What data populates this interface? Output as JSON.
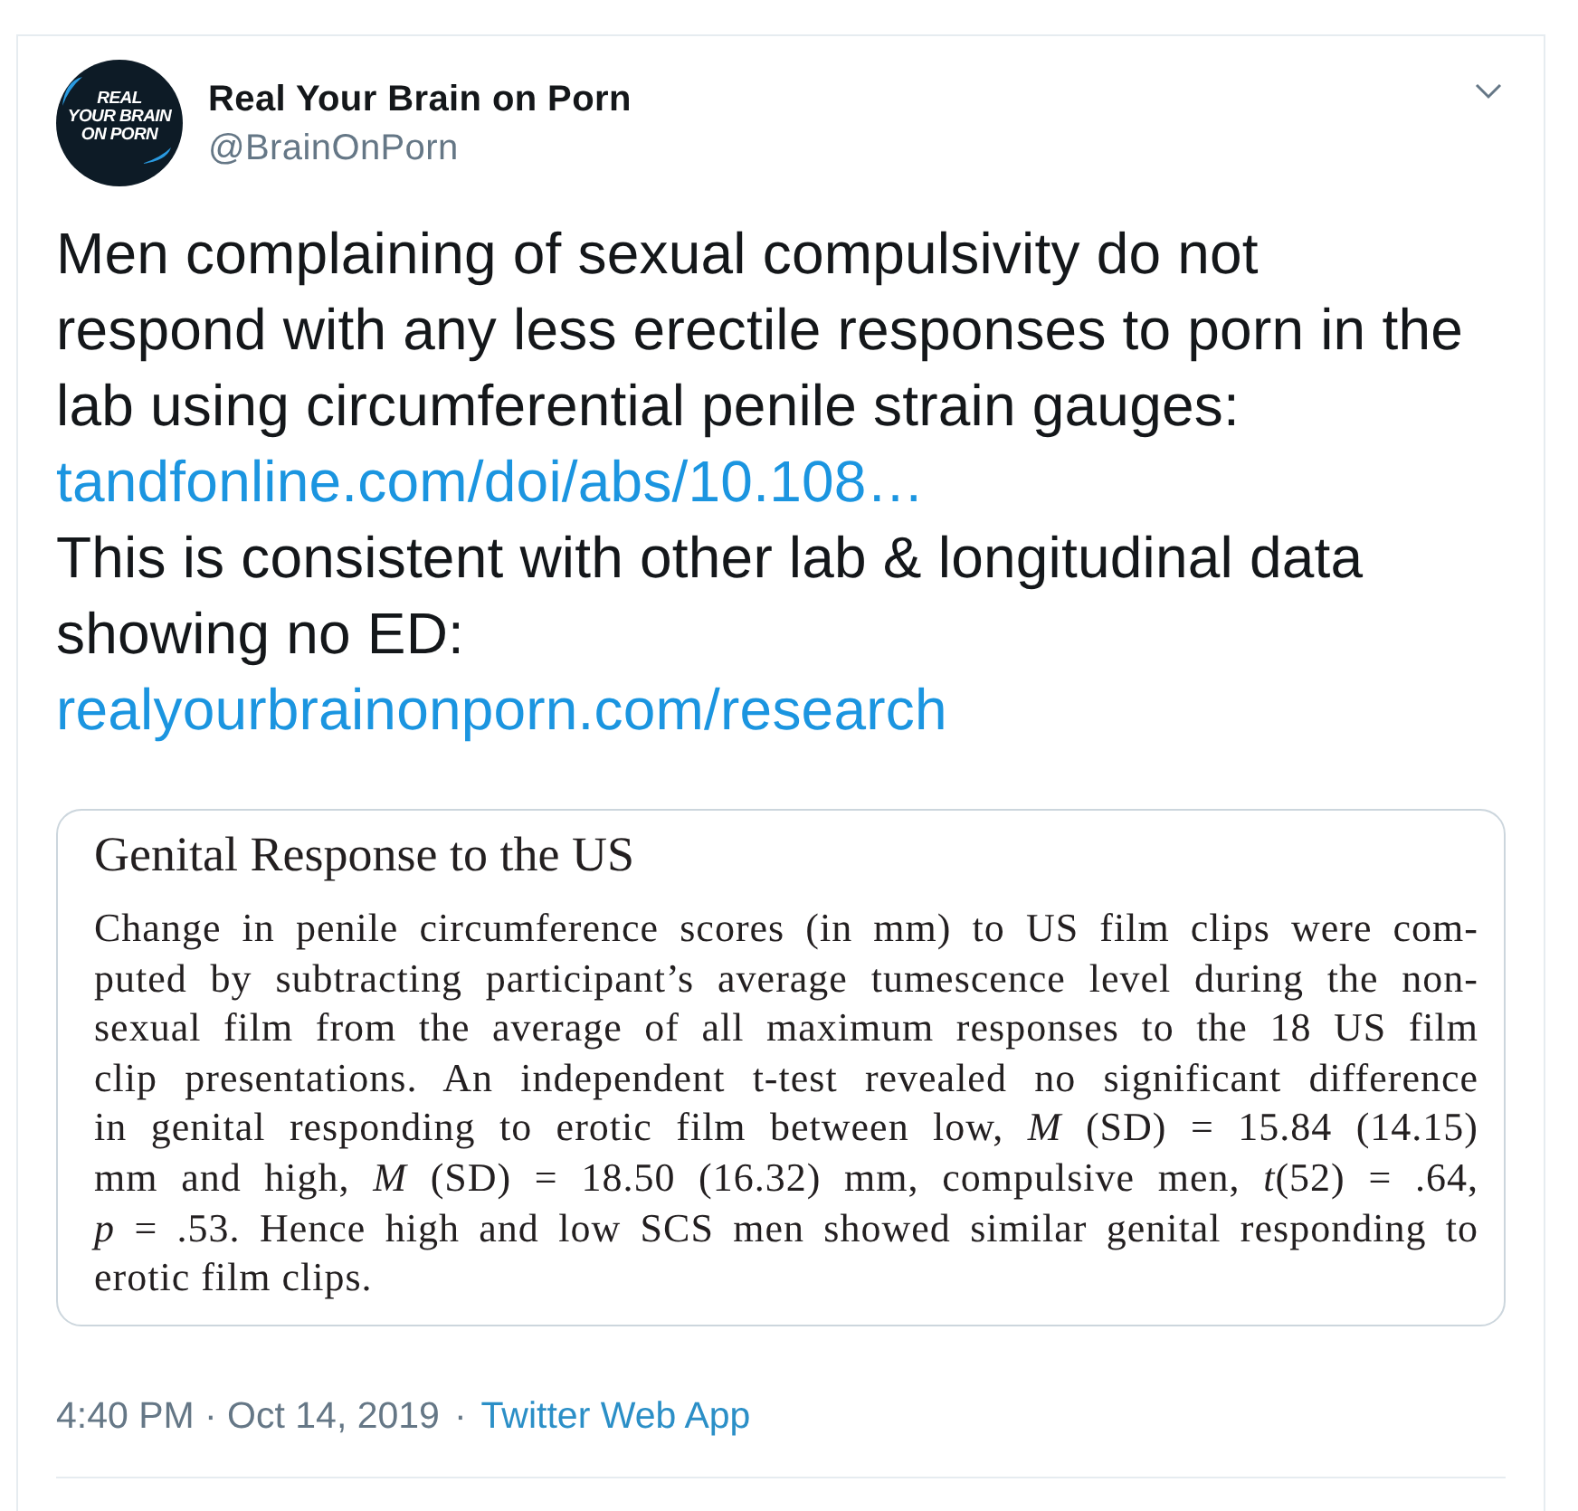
{
  "author": {
    "avatar": {
      "lines": [
        "REAL",
        "YOUR BRAIN",
        "ON PORN"
      ]
    },
    "name": "Real Your Brain on Porn",
    "handle": "@BrainOnPorn"
  },
  "body": [
    {
      "kind": "text",
      "text": "Men complaining of sexual compulsivity do not respond with any less erectile responses to porn in the lab using circumferential penile strain gauges:"
    },
    {
      "kind": "link",
      "text": "tandfonline.com/doi/abs/10.108…"
    },
    {
      "kind": "text",
      "text": "This is consistent with other lab & longitudinal data showing no ED:"
    },
    {
      "kind": "link",
      "text": "realyourbrainonporn.com/research"
    }
  ],
  "excerpt": {
    "title": "Genital Response to the US",
    "lines": [
      "Change in penile circumference scores (in mm) to US film clips were com-",
      "puted by subtracting participant’s average tumescence level during the non-",
      "sexual film from the average of all maximum responses to the 18 US film",
      "clip presentations. An independent t-test revealed no significant difference",
      "in genital responding to erotic film between low, *M* (SD) = 15.84 (14.15)",
      "mm and high, *M* (SD) = 18.50 (16.32) mm, compulsive men, *t*(52) = .64,",
      "*p* = .53. Hence high and low SCS men showed similar genital responding to",
      "erotic film clips."
    ]
  },
  "footer": {
    "timestamp": "4:40 PM · Oct 14, 2019",
    "separator": "·",
    "source": "Twitter Web App"
  }
}
